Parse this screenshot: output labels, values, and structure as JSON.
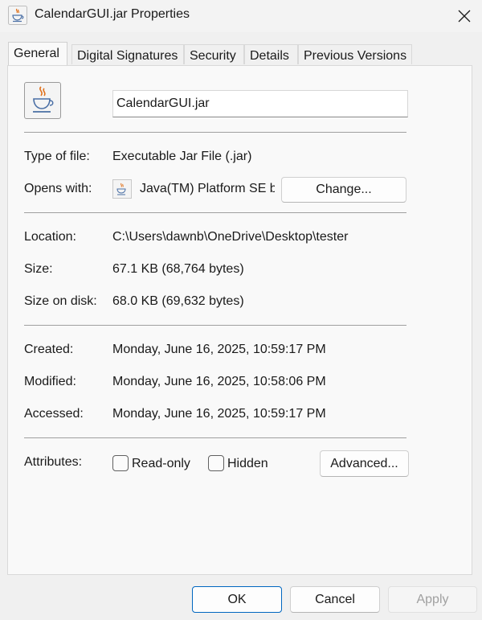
{
  "window": {
    "title": "CalendarGUI.jar Properties",
    "icon": "java-icon"
  },
  "tabs": [
    {
      "label": "General",
      "active": true
    },
    {
      "label": "Digital Signatures",
      "active": false
    },
    {
      "label": "Security",
      "active": false
    },
    {
      "label": "Details",
      "active": false
    },
    {
      "label": "Previous Versions",
      "active": false
    }
  ],
  "general": {
    "file_name": "CalendarGUI.jar",
    "type_of_file": {
      "label": "Type of file:",
      "value": "Executable Jar File (.jar)"
    },
    "opens_with": {
      "label": "Opens with:",
      "value": "Java(TM) Platform SE binary",
      "button": "Change..."
    },
    "location": {
      "label": "Location:",
      "value": "C:\\Users\\dawnb\\OneDrive\\Desktop\\tester"
    },
    "size": {
      "label": "Size:",
      "value": "67.1 KB (68,764 bytes)"
    },
    "size_on_disk": {
      "label": "Size on disk:",
      "value": "68.0 KB (69,632 bytes)"
    },
    "created": {
      "label": "Created:",
      "value": "Monday, June 16, 2025, 10:59:17 PM"
    },
    "modified": {
      "label": "Modified:",
      "value": "Monday, June 16, 2025, 10:58:06 PM"
    },
    "accessed": {
      "label": "Accessed:",
      "value": "Monday, June 16, 2025, 10:59:17 PM"
    },
    "attributes": {
      "label": "Attributes:",
      "read_only": {
        "label": "Read-only",
        "checked": false
      },
      "hidden": {
        "label": "Hidden",
        "checked": false
      },
      "advanced_button": "Advanced..."
    }
  },
  "footer": {
    "ok": "OK",
    "cancel": "Cancel",
    "apply": "Apply"
  },
  "colors": {
    "accent": "#0067c0",
    "disabled_text": "#a0a0a0"
  }
}
